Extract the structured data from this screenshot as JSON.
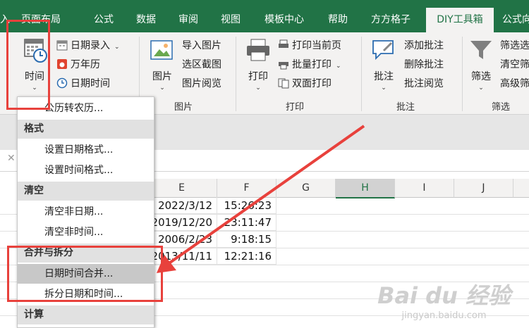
{
  "tabs": [
    "入",
    "页面布局",
    "公式",
    "数据",
    "审阅",
    "视图",
    "模板中心",
    "帮助",
    "方方格子",
    "DIY工具箱",
    "公式向"
  ],
  "active_tab": "DIY工具箱",
  "ribbon": {
    "time_group": {
      "big_label": "时间",
      "items": [
        "日期录入",
        "万年历",
        "日期时间"
      ],
      "item_chevron": "⌄"
    },
    "picture_group": {
      "big_label": "图片",
      "items": [
        "导入图片",
        "选区截图",
        "图片阅览"
      ],
      "label": "图片"
    },
    "print_group": {
      "big_label": "打印",
      "items": [
        "打印当前页",
        "批量打印",
        "双面打印"
      ],
      "label": "打印"
    },
    "comment_group": {
      "big_label": "批注",
      "items": [
        "添加批注",
        "删除批注",
        "批注阅览"
      ],
      "label": "批注"
    },
    "filter_group": {
      "big_label": "筛选",
      "items": [
        "筛选选",
        "清空筛",
        "高级筛"
      ],
      "label": "筛选"
    }
  },
  "formula_bar": {
    "cancel_glyph": "✕"
  },
  "columns": [
    "E",
    "F",
    "G",
    "H",
    "I",
    "J"
  ],
  "selected_column": "H",
  "cells": {
    "E": [
      "2022/3/12",
      "2019/12/20",
      "2006/2/23",
      "2013/11/11"
    ],
    "F": [
      "15:26:23",
      "23:11:47",
      "9:18:15",
      "12:21:16"
    ]
  },
  "menu": {
    "top_item": "公历转农历...",
    "sections": [
      {
        "header": "格式",
        "items": [
          "设置日期格式...",
          "设置时间格式..."
        ]
      },
      {
        "header": "清空",
        "items": [
          "清空非日期...",
          "清空非时间..."
        ]
      },
      {
        "header": "合并与拆分",
        "items": [
          "日期时间合并...",
          "拆分日期和时间..."
        ]
      },
      {
        "header": "计算",
        "items": []
      }
    ],
    "highlighted_item": "日期时间合并..."
  },
  "watermark": {
    "logo": "Bai du 经验",
    "url": "jingyan.baidu.com"
  },
  "colors": {
    "excel_green": "#217346",
    "annotation_red": "#e8413c",
    "menu_highlight": "#c8c8c8"
  }
}
